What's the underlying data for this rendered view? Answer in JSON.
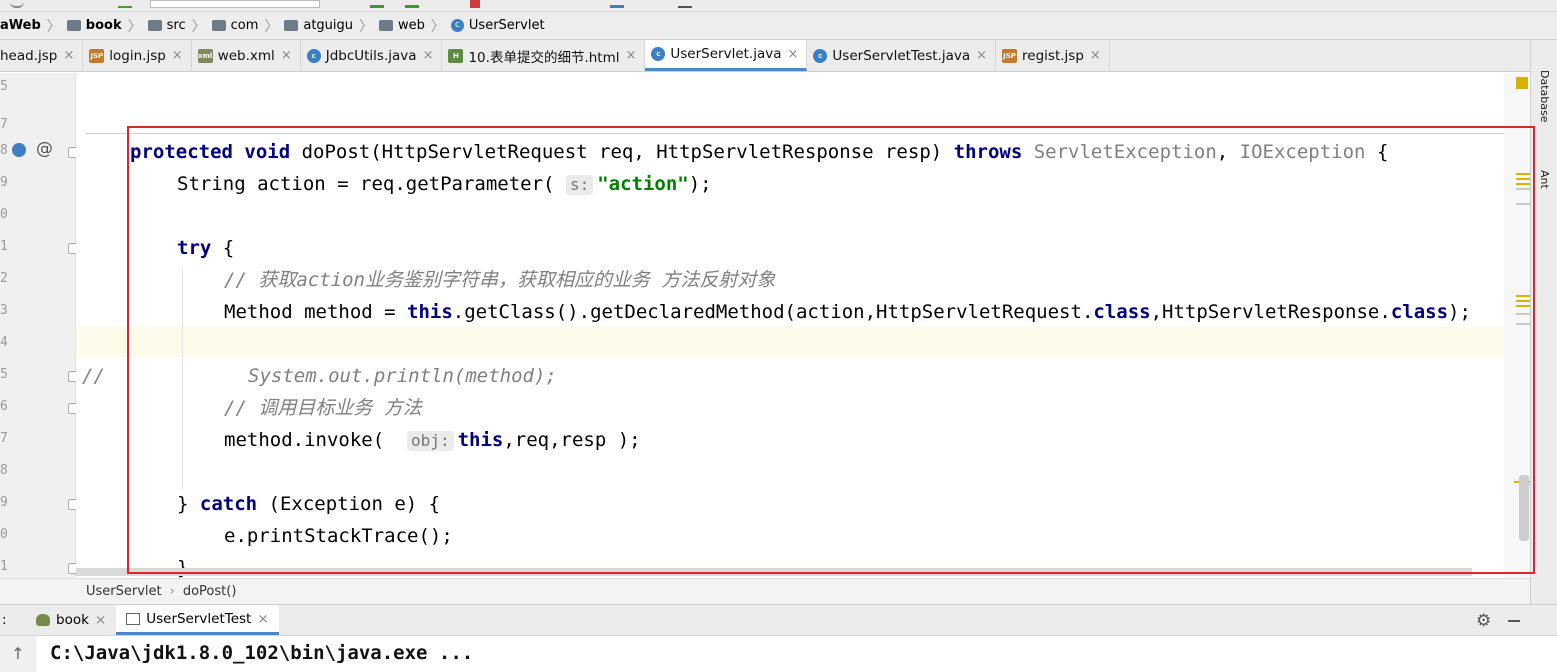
{
  "breadcrumb": [
    {
      "label": "aWeb",
      "icon": "folder-icon"
    },
    {
      "label": "book",
      "icon": "folder-icon"
    },
    {
      "label": "src",
      "icon": "folder-icon"
    },
    {
      "label": "com",
      "icon": "folder-icon"
    },
    {
      "label": "atguigu",
      "icon": "folder-icon"
    },
    {
      "label": "web",
      "icon": "folder-icon"
    },
    {
      "label": "UserServlet",
      "icon": "class-icon"
    }
  ],
  "tabs": [
    {
      "label": "head.jsp",
      "icon": "jsp-icon",
      "icon_text": "JSP",
      "active": false
    },
    {
      "label": "login.jsp",
      "icon": "jsp-icon",
      "icon_text": "JSP",
      "active": false
    },
    {
      "label": "web.xml",
      "icon": "xml-icon",
      "icon_text": "xml",
      "active": false
    },
    {
      "label": "JdbcUtils.java",
      "icon": "class-icon",
      "icon_text": "c",
      "active": false
    },
    {
      "label": "10.表单提交的细节.html",
      "icon": "html-icon",
      "icon_text": "H",
      "active": false
    },
    {
      "label": "UserServlet.java",
      "icon": "class-icon",
      "icon_text": "c",
      "active": true
    },
    {
      "label": "UserServletTest.java",
      "icon": "class-icon",
      "icon_text": "c",
      "active": false
    },
    {
      "label": "regist.jsp",
      "icon": "jsp-icon",
      "icon_text": "JSP",
      "active": false
    }
  ],
  "right_tools": [
    "Database",
    "Ant"
  ],
  "gutter": {
    "line_numbers": [
      "5",
      "7",
      "8",
      "9",
      "0",
      "1",
      "2",
      "3",
      "4",
      "5",
      "6",
      "7",
      "8",
      "9",
      "0",
      "1"
    ],
    "override_marker": "@"
  },
  "code": {
    "l1_kw1": "protected",
    "l1_kw2": "void",
    "l1_sig": " doPost(HttpServletRequest req, HttpServletResponse resp) ",
    "l1_kw3": "throws",
    "l1_exc1": "ServletException",
    "l1_comma": ", ",
    "l1_exc2": "IOException",
    "l1_end": " {",
    "l2_a": "String action = req.getParameter(",
    "l2_hint": "s:",
    "l2_str": "\"action\"",
    "l2_end": ");",
    "l3_kw": "try",
    "l3_end": " {",
    "l4_cmt": "// 获取action业务鉴别字符串，获取相应的业务 方法反射对象",
    "l5_a": "Method method = ",
    "l5_kw1": "this",
    "l5_b": ".getClass().getDeclaredMethod(action,HttpServletRequest.",
    "l5_kw2": "class",
    "l5_c": ",HttpServletResponse.",
    "l5_kw3": "class",
    "l5_end": ");",
    "l6_prefix": "//",
    "l6_cmt": "System.out.println(method);",
    "l7_cmt": "// 调用目标业务 方法",
    "l8_a": "method.invoke(",
    "l8_hint": "obj:",
    "l8_kw": "this",
    "l8_end": ",req,resp );",
    "l9_a": "} ",
    "l9_kw": "catch",
    "l9_end": " (Exception e) {",
    "l10": "e.printStackTrace();",
    "l11": "}"
  },
  "method_breadcrumb": {
    "cls": "UserServlet",
    "method": "doPost()"
  },
  "run": {
    "prefix": ":",
    "tabs": [
      {
        "label": "book",
        "icon": "bug-icon"
      },
      {
        "label": "UserServletTest",
        "icon": "console-icon"
      }
    ],
    "console_line": "C:\\Java\\jdk1.8.0_102\\bin\\java.exe ...",
    "up_arrow": "↑"
  },
  "colors": {
    "keyword": "#000080",
    "string": "#008000",
    "comment": "#808080",
    "highlight_box": "#e0252f"
  }
}
